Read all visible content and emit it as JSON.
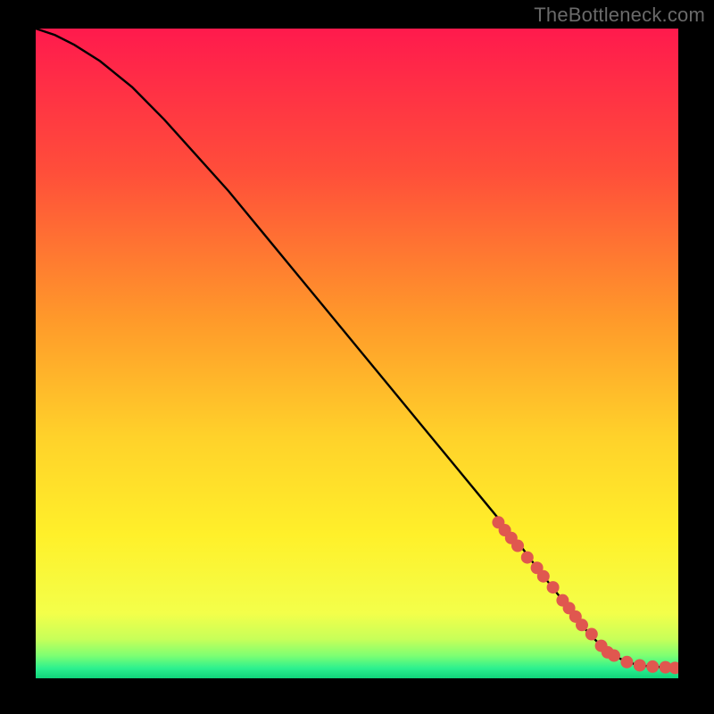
{
  "attribution": "TheBottleneck.com",
  "colors": {
    "background": "#000000",
    "curve": "#000000",
    "marker": "#e0574f",
    "gradient_stops": [
      {
        "offset": 0.0,
        "color": "#ff1a4d"
      },
      {
        "offset": 0.22,
        "color": "#ff4e3a"
      },
      {
        "offset": 0.45,
        "color": "#ff9a2a"
      },
      {
        "offset": 0.63,
        "color": "#ffd22a"
      },
      {
        "offset": 0.78,
        "color": "#fff02a"
      },
      {
        "offset": 0.9,
        "color": "#f3ff4a"
      },
      {
        "offset": 0.94,
        "color": "#c7ff59"
      },
      {
        "offset": 0.965,
        "color": "#7eff72"
      },
      {
        "offset": 0.985,
        "color": "#2bf08f"
      },
      {
        "offset": 1.0,
        "color": "#10d47a"
      }
    ]
  },
  "chart_data": {
    "type": "line",
    "title": "",
    "xlabel": "",
    "ylabel": "",
    "xlim": [
      0,
      100
    ],
    "ylim": [
      0,
      100
    ],
    "legend": false,
    "grid": false,
    "series": [
      {
        "name": "curve",
        "x": [
          0,
          3,
          6,
          10,
          15,
          20,
          25,
          30,
          35,
          40,
          45,
          50,
          55,
          60,
          65,
          70,
          75,
          78,
          80,
          82,
          84,
          86,
          88,
          90,
          92,
          94,
          96,
          98,
          100
        ],
        "y": [
          100,
          99,
          97.5,
          95,
          91,
          86,
          80.5,
          75,
          69,
          63,
          57,
          51,
          45,
          39,
          33,
          27,
          21,
          17,
          14.5,
          12,
          9.5,
          7,
          5,
          3.5,
          2.5,
          2,
          1.8,
          1.7,
          1.6
        ]
      }
    ],
    "markers": {
      "name": "points",
      "color": "#e0574f",
      "radius_px": 7,
      "x": [
        72,
        73,
        74,
        75,
        76.5,
        78,
        79,
        80.5,
        82,
        83,
        84,
        85,
        86.5,
        88,
        89,
        90,
        92,
        94,
        96,
        98,
        99.5
      ],
      "y": [
        24,
        22.8,
        21.6,
        20.4,
        18.6,
        17,
        15.7,
        14,
        12,
        10.8,
        9.5,
        8.2,
        6.8,
        5,
        4,
        3.5,
        2.5,
        2,
        1.8,
        1.7,
        1.6
      ]
    }
  }
}
